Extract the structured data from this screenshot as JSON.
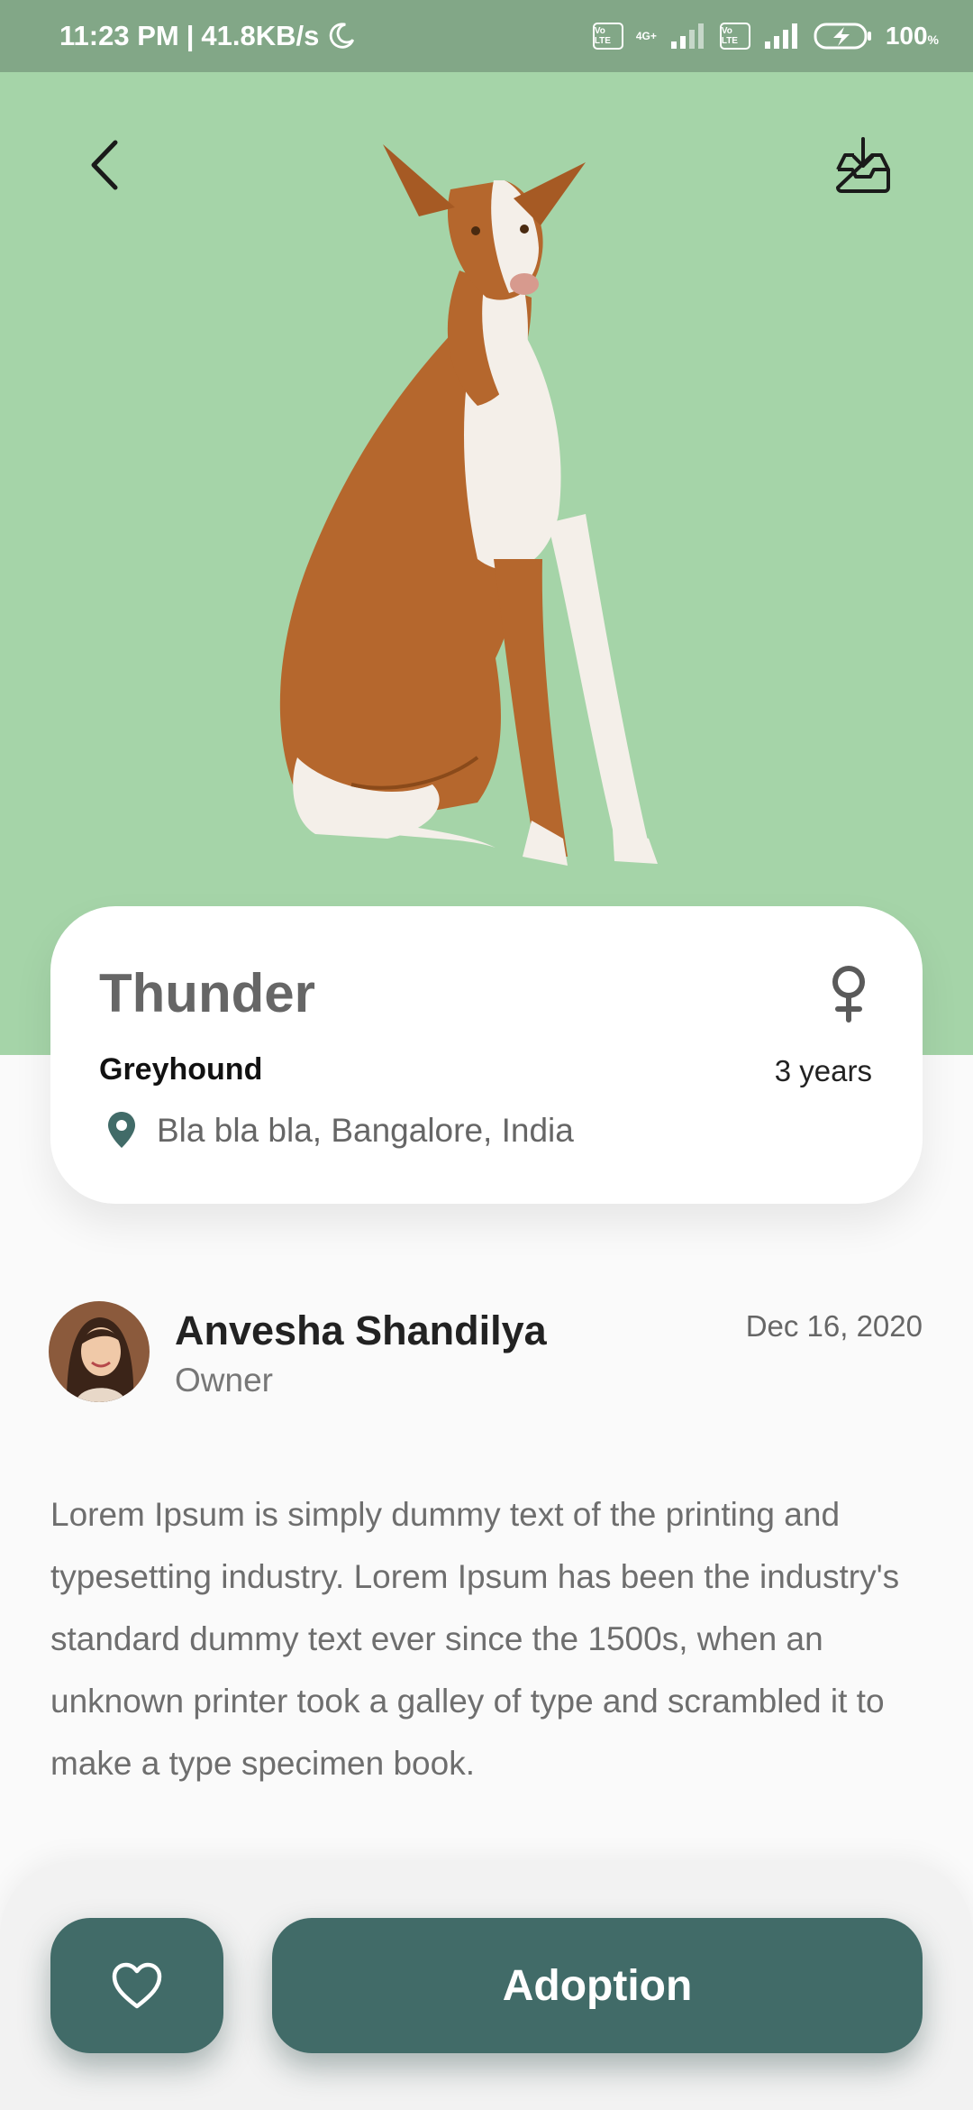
{
  "status_bar": {
    "time": "11:23 PM",
    "net_speed": "41.8KB/s",
    "volte_1": "Vo LTE",
    "net_type": "4G+",
    "volte_2": "Vo LTE",
    "battery": "100",
    "battery_unit": "%"
  },
  "pet": {
    "name": "Thunder",
    "breed": "Greyhound",
    "age": "3 years",
    "location": "Bla bla bla, Bangalore, India",
    "gender_icon": "female-icon"
  },
  "owner": {
    "name": "Anvesha Shandilya",
    "role": "Owner",
    "date": "Dec 16, 2020"
  },
  "description": "Lorem Ipsum is simply dummy text of the printing and typesetting industry. Lorem Ipsum has been the industry's standard dummy text ever since the 1500s, when an unknown printer took a galley of type and scrambled it to make a type specimen book.",
  "actions": {
    "adopt_label": "Adoption",
    "favorite_icon": "heart-icon"
  },
  "colors": {
    "hero_bg": "#a5d4a8",
    "status_bar_bg": "#82a787",
    "accent": "#416b68"
  }
}
